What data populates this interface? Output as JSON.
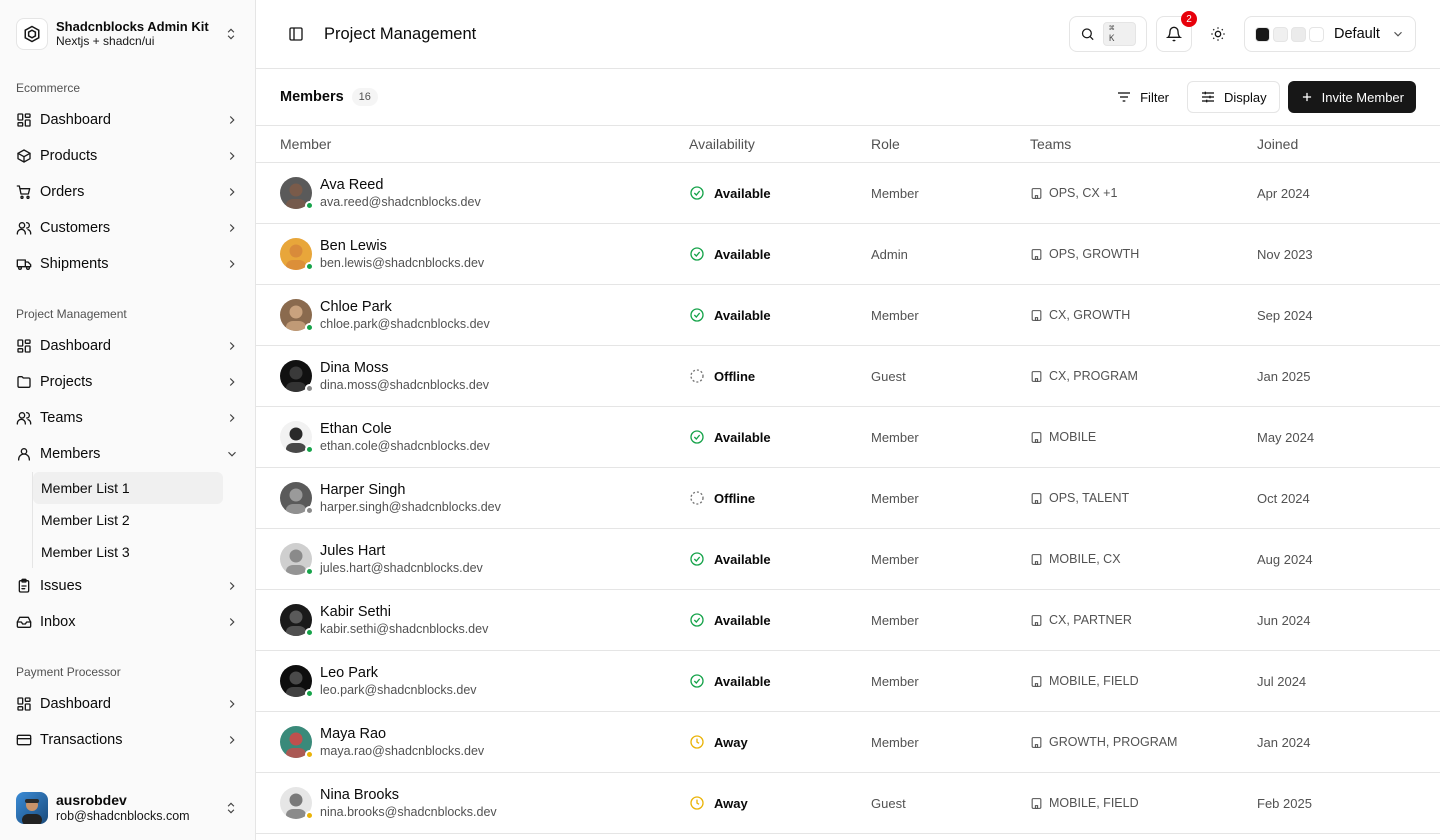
{
  "brand": {
    "title": "Shadcnblocks Admin Kit",
    "subtitle": "Nextjs + shadcn/ui"
  },
  "sidebar": {
    "groups": [
      {
        "label": "Ecommerce",
        "items": [
          {
            "label": "Dashboard",
            "icon": "layout-dashboard-icon"
          },
          {
            "label": "Products",
            "icon": "package-icon"
          },
          {
            "label": "Orders",
            "icon": "shopping-cart-icon"
          },
          {
            "label": "Customers",
            "icon": "users-icon"
          },
          {
            "label": "Shipments",
            "icon": "truck-icon"
          }
        ]
      },
      {
        "label": "Project Management",
        "items": [
          {
            "label": "Dashboard",
            "icon": "layout-dashboard-icon"
          },
          {
            "label": "Projects",
            "icon": "folder-icon"
          },
          {
            "label": "Teams",
            "icon": "users-icon"
          },
          {
            "label": "Members",
            "icon": "user-icon",
            "expanded": true,
            "children": [
              "Member List 1",
              "Member List 2",
              "Member List 3"
            ]
          },
          {
            "label": "Issues",
            "icon": "clipboard-icon"
          },
          {
            "label": "Inbox",
            "icon": "inbox-icon"
          }
        ]
      },
      {
        "label": "Payment Processor",
        "items": [
          {
            "label": "Dashboard",
            "icon": "layout-dashboard-icon"
          },
          {
            "label": "Transactions",
            "icon": "credit-card-icon"
          }
        ]
      }
    ]
  },
  "user": {
    "name": "ausrobdev",
    "email": "rob@shadcnblocks.com"
  },
  "header": {
    "title": "Project Management",
    "search_shortcut": "⌘ K",
    "notification_count": "2",
    "theme_label": "Default",
    "swatch_colors": [
      "#171717",
      "#f0f0f0",
      "#ebebeb",
      "#ffffff"
    ]
  },
  "toolbar": {
    "title": "Members",
    "count": "16",
    "filter_label": "Filter",
    "display_label": "Display",
    "invite_label": "Invite Member"
  },
  "table": {
    "headers": [
      "Member",
      "Availability",
      "Role",
      "Teams",
      "Joined"
    ],
    "rows": [
      {
        "name": "Ava Reed",
        "email": "ava.reed@shadcnblocks.dev",
        "availability": "Available",
        "role": "Member",
        "teams": "OPS, CX +1",
        "joined": "Apr 2024",
        "skin": "#7a5b4a",
        "bg": "#5a5a5a"
      },
      {
        "name": "Ben Lewis",
        "email": "ben.lewis@shadcnblocks.dev",
        "availability": "Available",
        "role": "Admin",
        "teams": "OPS, GROWTH",
        "joined": "Nov 2023",
        "skin": "#d98b3a",
        "bg": "#e8a63a"
      },
      {
        "name": "Chloe Park",
        "email": "chloe.park@shadcnblocks.dev",
        "availability": "Available",
        "role": "Member",
        "teams": "CX, GROWTH",
        "joined": "Sep 2024",
        "skin": "#c9a27e",
        "bg": "#8a6a4e"
      },
      {
        "name": "Dina Moss",
        "email": "dina.moss@shadcnblocks.dev",
        "availability": "Offline",
        "role": "Guest",
        "teams": "CX, PROGRAM",
        "joined": "Jan 2025",
        "skin": "#3a3a3a",
        "bg": "#111111"
      },
      {
        "name": "Ethan Cole",
        "email": "ethan.cole@shadcnblocks.dev",
        "availability": "Available",
        "role": "Member",
        "teams": "MOBILE",
        "joined": "May 2024",
        "skin": "#2a2a2a",
        "bg": "#f2f2f2"
      },
      {
        "name": "Harper Singh",
        "email": "harper.singh@shadcnblocks.dev",
        "availability": "Offline",
        "role": "Member",
        "teams": "OPS, TALENT",
        "joined": "Oct 2024",
        "skin": "#9a9a9a",
        "bg": "#5a5a5a"
      },
      {
        "name": "Jules Hart",
        "email": "jules.hart@shadcnblocks.dev",
        "availability": "Available",
        "role": "Member",
        "teams": "MOBILE, CX",
        "joined": "Aug 2024",
        "skin": "#8a8a8a",
        "bg": "#cfcfcf"
      },
      {
        "name": "Kabir Sethi",
        "email": "kabir.sethi@shadcnblocks.dev",
        "availability": "Available",
        "role": "Member",
        "teams": "CX, PARTNER",
        "joined": "Jun 2024",
        "skin": "#5a5a5a",
        "bg": "#1a1a1a"
      },
      {
        "name": "Leo Park",
        "email": "leo.park@shadcnblocks.dev",
        "availability": "Available",
        "role": "Member",
        "teams": "MOBILE, FIELD",
        "joined": "Jul 2024",
        "skin": "#4a4a4a",
        "bg": "#0e0e0e"
      },
      {
        "name": "Maya Rao",
        "email": "maya.rao@shadcnblocks.dev",
        "availability": "Away",
        "role": "Member",
        "teams": "GROWTH, PROGRAM",
        "joined": "Jan 2024",
        "skin": "#c0504d",
        "bg": "#3a8a7a"
      },
      {
        "name": "Nina Brooks",
        "email": "nina.brooks@shadcnblocks.dev",
        "availability": "Away",
        "role": "Guest",
        "teams": "MOBILE, FIELD",
        "joined": "Feb 2025",
        "skin": "#7a7a7a",
        "bg": "#e6e6e6"
      }
    ]
  },
  "colors": {
    "available": "#16a34a",
    "offline": "#8a8a8a",
    "away": "#eab308",
    "accent": "#171717",
    "badge": "#e7000b"
  }
}
